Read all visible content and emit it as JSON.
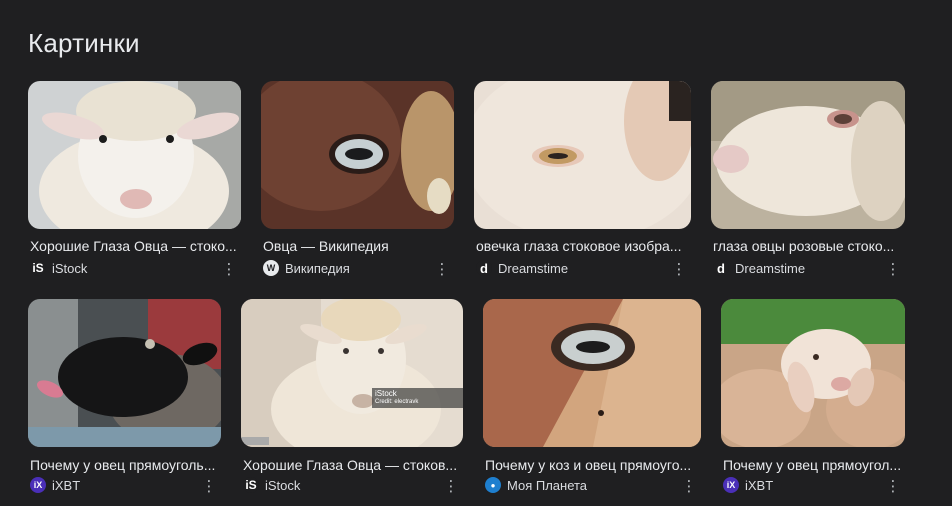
{
  "section": {
    "title": "Картинки"
  },
  "results": [
    {
      "caption": "Хорошие Глаза Овца — стоко...",
      "source": "iStock",
      "favicon": "istock"
    },
    {
      "caption": "Овца — Википедия",
      "source": "Википедия",
      "favicon": "wikipedia"
    },
    {
      "caption": "овечка глаза стоковое изобра...",
      "source": "Dreamstime",
      "favicon": "dreamstime"
    },
    {
      "caption": "глаза овцы розовые стоко...",
      "source": "Dreamstime",
      "favicon": "dreamstime"
    },
    {
      "caption": "Почему у овец прямоуголь...",
      "source": "iXBT",
      "favicon": "ixbt"
    },
    {
      "caption": "Хорошие Глаза Овца — стоков...",
      "source": "iStock",
      "favicon": "istock",
      "watermark": "iStock",
      "watermark_credit": "Credit: electravk"
    },
    {
      "caption": "Почему у коз и овец прямоуго...",
      "source": "Моя Планета",
      "favicon": "moya-planeta"
    },
    {
      "caption": "Почему у овец прямоугол...",
      "source": "iXBT",
      "favicon": "ixbt"
    }
  ],
  "favicon_text": {
    "istock": "iS",
    "wikipedia": "W",
    "dreamstime": "d",
    "ixbt": "iX",
    "moya-planeta": "●"
  },
  "more_glyph": "⋮"
}
